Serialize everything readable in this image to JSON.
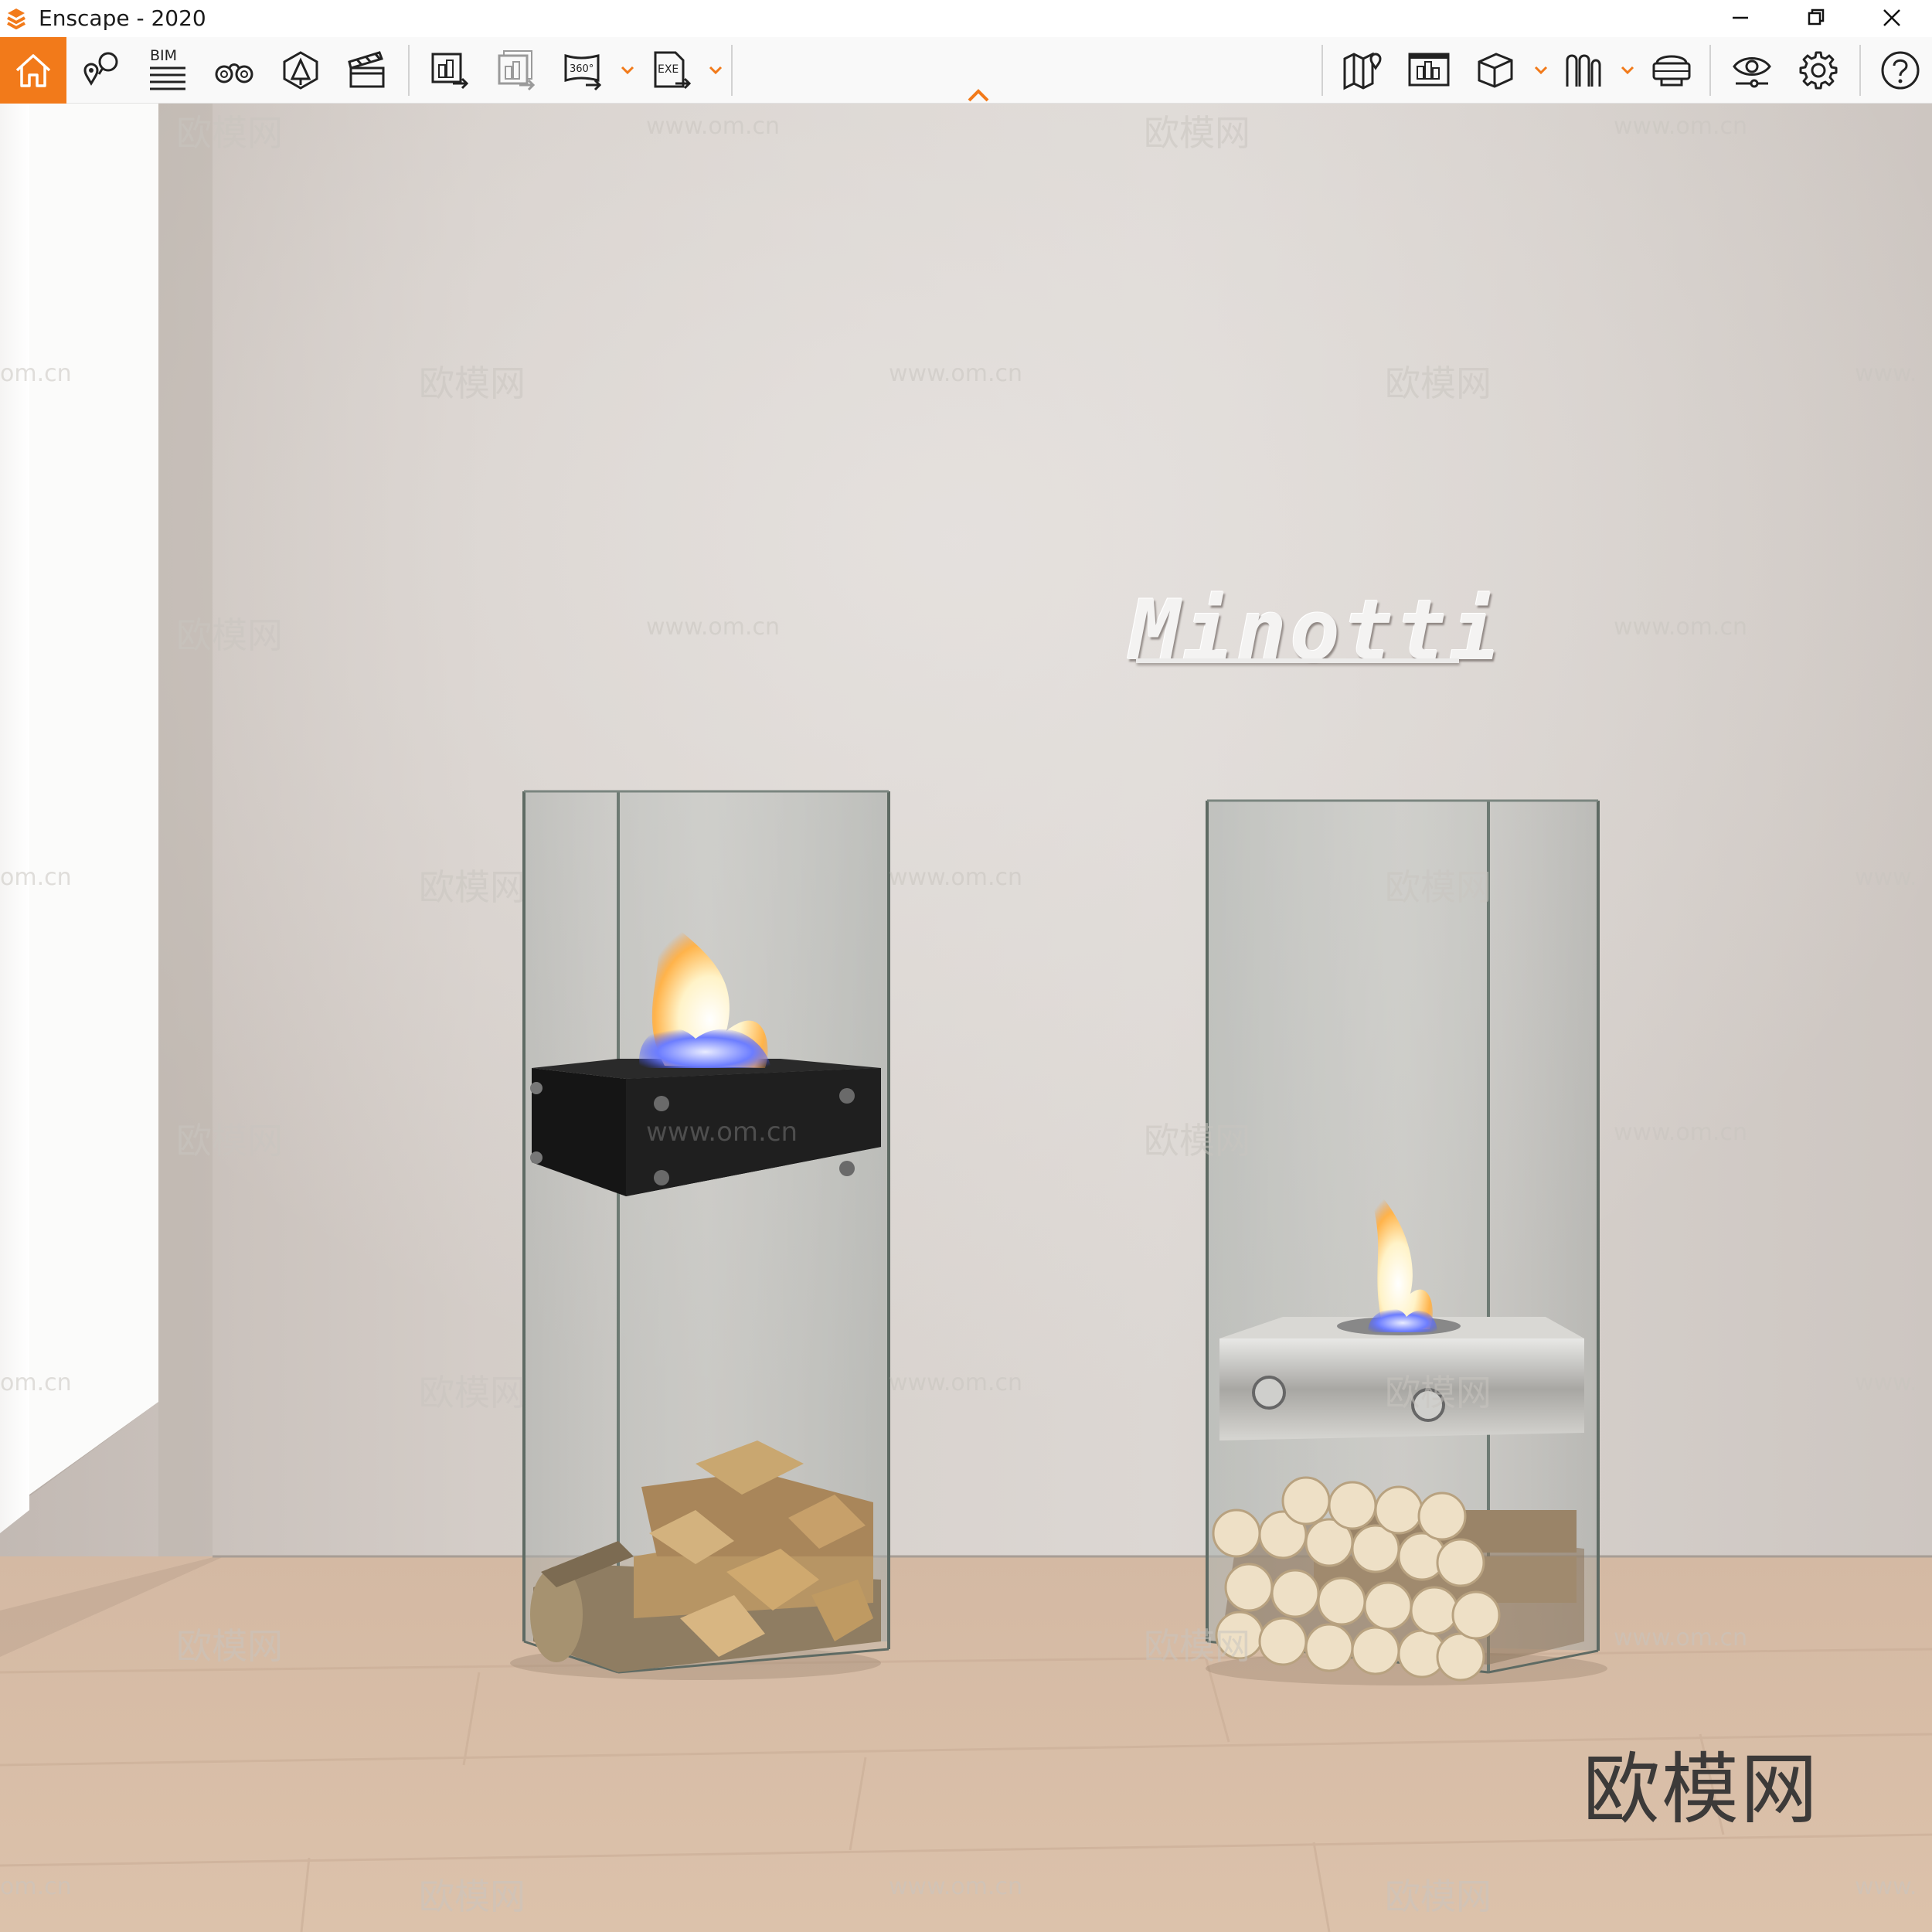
{
  "window": {
    "title": "Enscape - 2020",
    "controls": [
      "minimize",
      "restore",
      "close"
    ]
  },
  "toolbar": {
    "bim_label": "BIM",
    "panorama_label": "360°",
    "exe_label": "EXE",
    "left_tools": [
      {
        "name": "home",
        "icon": "home-icon",
        "active": true
      },
      {
        "name": "views",
        "icon": "location-pins-icon"
      },
      {
        "name": "bim",
        "icon": "bim-list-icon"
      },
      {
        "name": "walk-mode",
        "icon": "binoculars-icon"
      },
      {
        "name": "asset-library",
        "icon": "asset-library-icon"
      },
      {
        "name": "video-editor",
        "icon": "clapperboard-icon"
      },
      {
        "name": "export-image",
        "icon": "export-image-icon"
      },
      {
        "name": "batch-export",
        "icon": "batch-export-icon"
      },
      {
        "name": "export-panorama",
        "icon": "panorama-360-icon"
      },
      {
        "name": "export-exe",
        "icon": "exe-export-icon"
      }
    ],
    "right_tools": [
      {
        "name": "map",
        "icon": "map-icon"
      },
      {
        "name": "panorama-gallery",
        "icon": "gallery-icon"
      },
      {
        "name": "views-cube",
        "icon": "cube-icon"
      },
      {
        "name": "section",
        "icon": "section-icon"
      },
      {
        "name": "vr-headset",
        "icon": "vr-headset-icon"
      },
      {
        "name": "visual-settings",
        "icon": "eye-icon"
      },
      {
        "name": "settings",
        "icon": "gear-icon"
      },
      {
        "name": "help",
        "icon": "help-icon"
      }
    ],
    "accent_color": "#f27a1a"
  },
  "scene": {
    "wall_sign": "Minotti",
    "watermark_cn": "欧模网",
    "watermark_url": "www.om.cn",
    "watermark_url_partial_left": "om.cn",
    "watermark_url_partial_right": "www.",
    "fireplace_plate_watermark": "www.om.cn",
    "corner_watermark": "欧模网"
  }
}
